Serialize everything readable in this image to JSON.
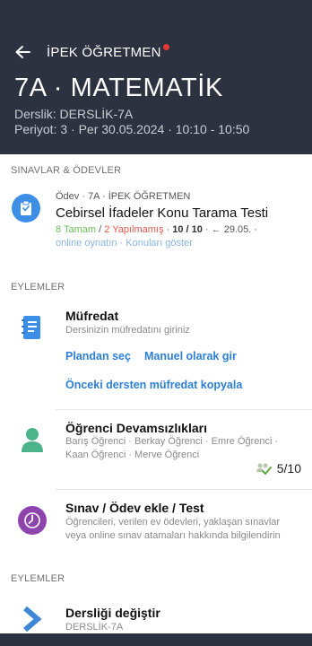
{
  "header": {
    "back_icon": "arrow-left-icon",
    "title": "İPEK ÖĞRETMEN",
    "class_title": "7A · MATEMATİK",
    "room": "Derslik: DERSLİK-7A",
    "period": "Periyot: 3 · Per 30.05.2024 · 10:10 - 10:50"
  },
  "exams": {
    "section_label": "SINAVLAR & ÖDEVLER",
    "item": {
      "icon": "clipboard-icon",
      "meta": "Ödev · 7A · İPEK ÖĞRETMEN",
      "title": "Cebirsel İfadeler Konu Tarama Testi",
      "done": "8 Tamam",
      "sep1": " / ",
      "not_done": "2 Yapılmamış",
      "sep2": " · ",
      "score": "10 / 10",
      "sep3": " · ← 29.05. ·",
      "online_link": "online oynatın",
      "sep4": " · ",
      "topics_link": "Konuları göster"
    }
  },
  "actions": {
    "section_label": "EYLEMLER",
    "curriculum": {
      "icon": "notebook-icon",
      "title": "Müfredat",
      "subtitle": "Dersinizin müfredatını giriniz",
      "plan_link": "Plandan seç",
      "manual_link": "Manuel olarak gir",
      "copy_link": "Önceki dersten müfredat kopyala"
    },
    "attendance": {
      "icon": "person-icon",
      "title": "Öğrenci Devamsızlıkları",
      "students_line1": "Barış Öğrenci · Berkay Öğrenci · Emre Öğrenci ·",
      "students_line2": "Kaan Öğrenci · Merve Öğrenci",
      "count_icon": "group-check-icon",
      "count": "5/10"
    },
    "exam_add": {
      "icon": "clock-icon",
      "title": "Sınav / Ödev ekle / Test",
      "subtitle_line1": "Öğrencileri, verilen ev ödevleri, yaklaşan sınavlar",
      "subtitle_line2": "veya online sınav atamaları hakkında bilgilendirin"
    }
  },
  "actions2": {
    "section_label": "EYLEMLER",
    "change_room": {
      "icon": "chevron-right-icon",
      "title": "Dersliği değiştir",
      "subtitle": "DERSLİK-7A"
    }
  },
  "colors": {
    "header_bg": "#2c3240",
    "link_blue": "#2d7fd6",
    "done_green": "#6cbf5a",
    "not_done_red": "#e0574a",
    "clipboard_circle": "#3d8ee6",
    "person_green": "#4db38a",
    "clock_purple": "#8e44ad",
    "chevron_blue": "#3f86d6"
  }
}
